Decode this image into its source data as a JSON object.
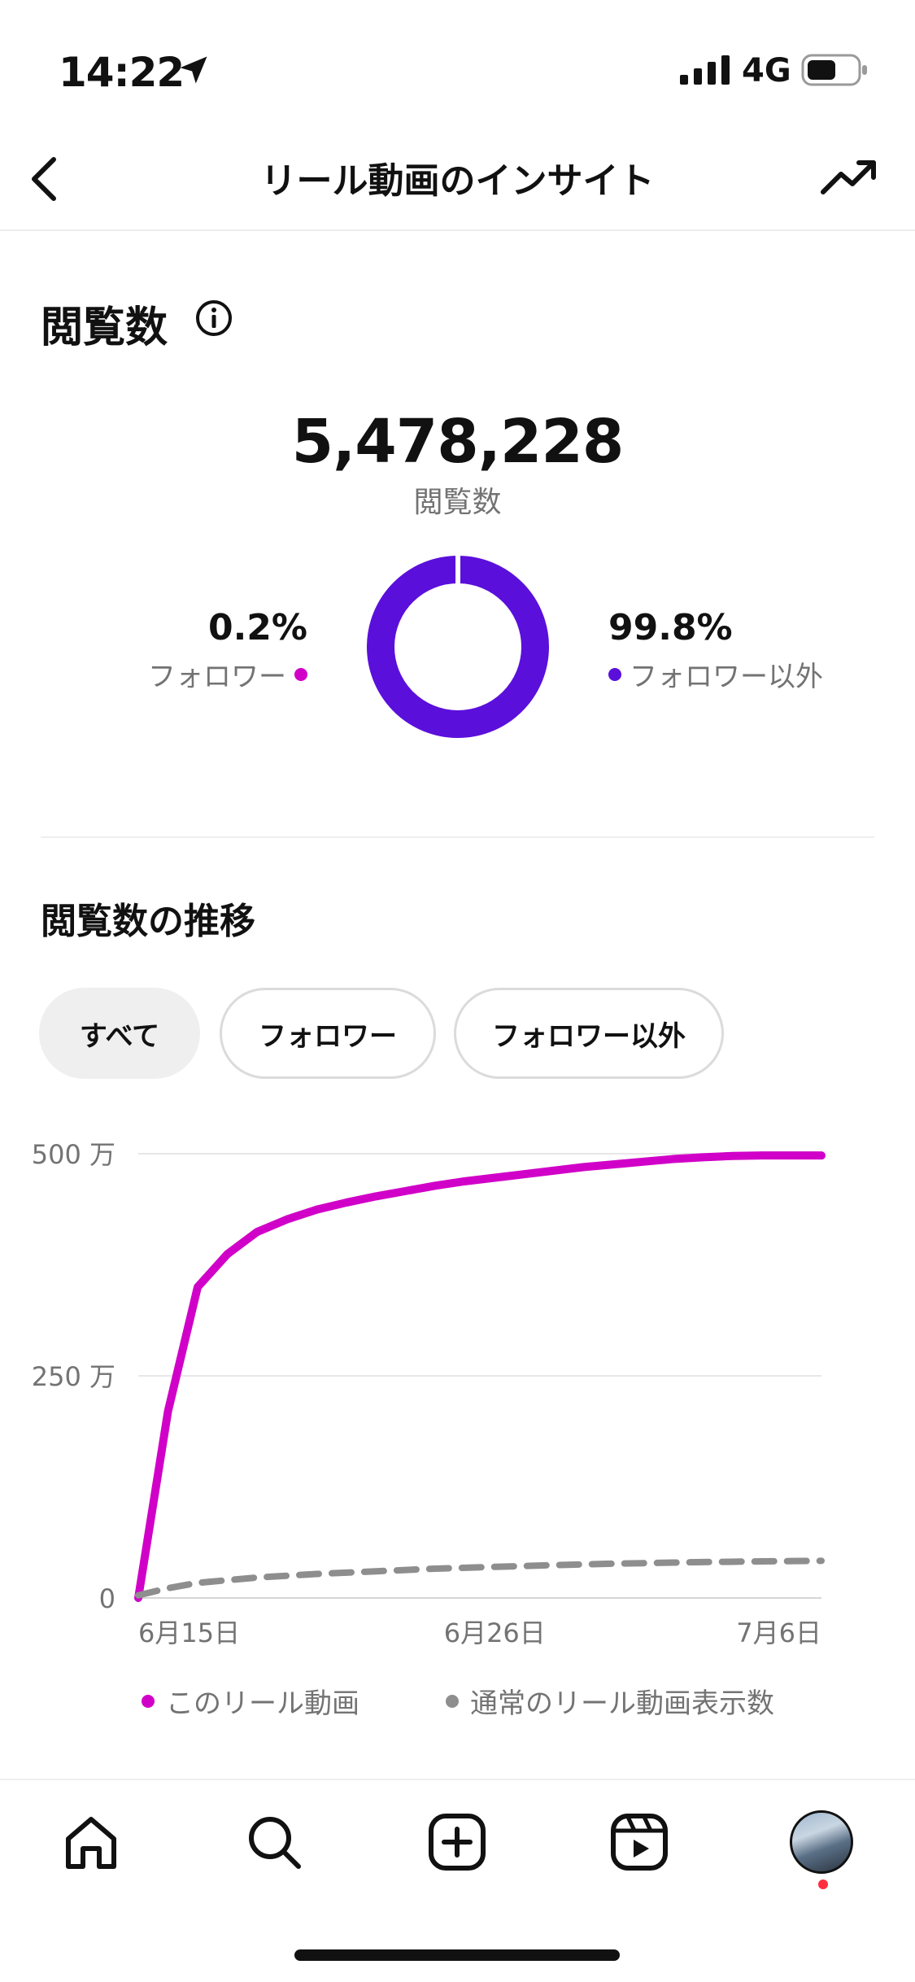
{
  "status_bar": {
    "time": "14:22",
    "network": "4G",
    "icons": [
      "location-arrow-icon",
      "signal-icon",
      "battery-icon"
    ]
  },
  "header": {
    "title": "リール動画のインサイト",
    "back_icon": "chevron-left-icon",
    "trend_icon": "trending-up-icon"
  },
  "views": {
    "heading": "閲覧数",
    "total": "5,478,228",
    "total_label": "閲覧数",
    "followers_percent": "0.2%",
    "followers_label": "フォロワー",
    "nonfollowers_percent": "99.8%",
    "nonfollowers_label": "フォロワー以外",
    "donut_fractions": {
      "followers": 0.002,
      "nonfollowers": 0.998
    }
  },
  "trend": {
    "heading": "閲覧数の推移",
    "filters": [
      {
        "label": "すべて",
        "selected": true
      },
      {
        "label": "フォロワー",
        "selected": false
      },
      {
        "label": "フォロワー以外",
        "selected": false
      }
    ],
    "legend": {
      "this_reel": "このリール動画",
      "typical": "通常のリール動画表示数"
    }
  },
  "colors": {
    "followers": "#d100c8",
    "nonfollowers": "#5b0fdb",
    "typical": "#8e8e8e",
    "notification": "#ff2e3f"
  },
  "nav": {
    "items": [
      "home-icon",
      "search-icon",
      "create-icon",
      "reels-icon",
      "profile-avatar"
    ]
  },
  "chart_data": {
    "type": "line",
    "x": [
      0,
      1,
      2,
      3,
      4,
      5,
      6,
      7,
      8,
      9,
      10,
      11,
      12,
      13,
      14,
      15,
      16,
      17,
      18,
      19,
      20,
      21,
      22,
      23
    ],
    "x_tick_labels": [
      {
        "index": 1,
        "label": "6月15日"
      },
      {
        "index": 12,
        "label": "6月26日"
      },
      {
        "index": 22,
        "label": "7月6日"
      }
    ],
    "y_tick_labels": [
      {
        "value": 0,
        "label": "0"
      },
      {
        "value": 2500000,
        "label": "250 万"
      },
      {
        "value": 5000000,
        "label": "500 万"
      }
    ],
    "ylim": [
      0,
      5000000
    ],
    "grid": true,
    "series": [
      {
        "name": "このリール動画",
        "style": "solid",
        "values": [
          0,
          2100000,
          3500000,
          3870000,
          4120000,
          4260000,
          4370000,
          4450000,
          4520000,
          4580000,
          4640000,
          4690000,
          4730000,
          4770000,
          4810000,
          4850000,
          4880000,
          4910000,
          4940000,
          4960000,
          4975000,
          4980000,
          4980000,
          4980000
        ]
      },
      {
        "name": "通常のリール動画表示数",
        "style": "dashed",
        "values": [
          30000,
          110000,
          170000,
          200000,
          230000,
          250000,
          270000,
          285000,
          300000,
          315000,
          330000,
          340000,
          350000,
          360000,
          370000,
          378000,
          386000,
          392000,
          398000,
          404000,
          408000,
          412000,
          415000,
          418000
        ]
      }
    ]
  }
}
